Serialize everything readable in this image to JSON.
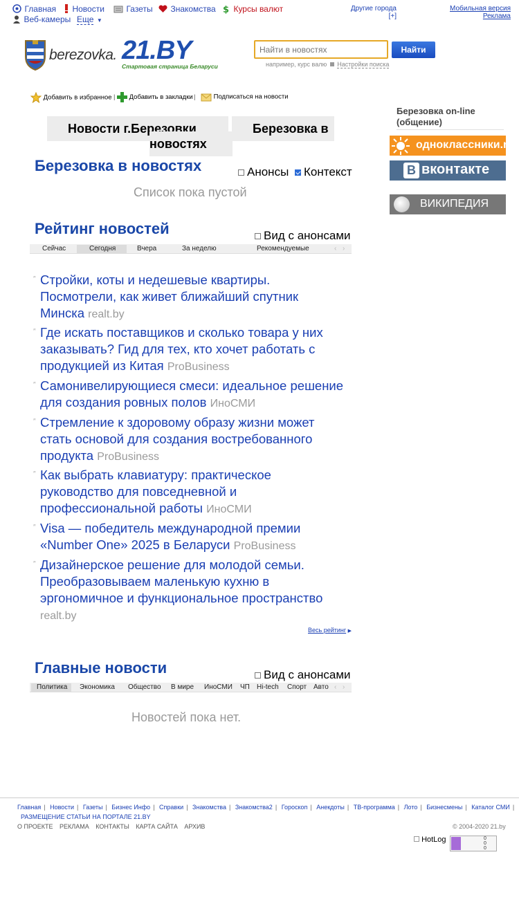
{
  "topnav": {
    "items": [
      {
        "label": "Главная",
        "icon": "home-icon"
      },
      {
        "label": "Новости",
        "icon": "exclamation-icon"
      },
      {
        "label": "Газеты",
        "icon": "newspaper-icon"
      },
      {
        "label": "Знакомства",
        "icon": "heart-icon"
      },
      {
        "label": "Курсы валют",
        "icon": "dollar-icon"
      }
    ],
    "webcams": "Веб-камеры",
    "more": "Еще",
    "other_cities": "Другие города",
    "other_cities_plus": "[+]",
    "mobile": "Мобильная версия",
    "ads": "Реклама"
  },
  "brand": {
    "city_logo_text": "berezovka.",
    "logo_text": "21.BY",
    "tagline": "Стартовая страница Беларуси"
  },
  "search": {
    "placeholder": "Найти в новостях",
    "button": "Найти",
    "example": "например, курс валю",
    "settings": "Настройки поиска"
  },
  "actions": {
    "favorites": "Добавить в избранное",
    "bookmarks": "Добавить в закладки",
    "subscribe": "Подписаться на новости"
  },
  "city_tabs": {
    "tab1": "Новости г.Березовки",
    "tab2": "Березовка в",
    "tab3": "новостях"
  },
  "sidebar": {
    "title": "Березовка on-line (общение)",
    "odnoklassniki": "одноклассники.ru",
    "vkontakte": "вконтакте",
    "wiki": "ВИКИПЕДИЯ"
  },
  "section1": {
    "title": "Березовка в новостях",
    "anons": "Анонсы",
    "context": "Контекст",
    "empty": "Список пока пустой"
  },
  "rating": {
    "title": "Рейтинг новостей",
    "view_anons": "Вид с анонсами",
    "tabs": [
      "Сейчас",
      "Сегодня",
      "Вчера",
      "За неделю",
      "Рекомендуемые"
    ],
    "items": [
      {
        "title": "Стройки, коты и недешевые квартиры. Посмотрели, как живет ближайший спутник Минска",
        "source": "realt.by"
      },
      {
        "title": "Где искать поставщиков и сколько товара у них заказывать? Гид для тех, кто хочет работать с продукцией из Китая",
        "source": "ProBusiness"
      },
      {
        "title": "Самонивелирующиеся смеси: идеальное решение для создания ровных полов",
        "source": "ИноСМИ"
      },
      {
        "title": "Стремление к здоровому образу жизни может стать основой для создания востребованного продукта",
        "source": "ProBusiness"
      },
      {
        "title": "Как выбрать клавиатуру: практическое руководство для повседневной и профессиональной работы",
        "source": "ИноСМИ"
      },
      {
        "title": "Visa — победитель международной премии «Number One» 2025 в Беларуси",
        "source": "ProBusiness"
      },
      {
        "title": "Дизайнерское решение для молодой семьи. Преобразовываем маленькую кухню в эргономичное и функциональное пространство",
        "source": "realt.by"
      }
    ],
    "all": "Весь рейтинг"
  },
  "main_news": {
    "title": "Главные новости",
    "view_anons": "Вид с анонсами",
    "tabs": [
      "Политика",
      "Экономика",
      "Общество",
      "В мире",
      "ИноСМИ",
      "ЧП",
      "Hi-tech",
      "Спорт",
      "Авто"
    ],
    "empty": "Новостей пока нет."
  },
  "footer": {
    "links": [
      "Главная",
      "Новости",
      "Газеты",
      "Бизнес Инфо",
      "Справки",
      "Знакомства",
      "Знакомства2",
      "Гороскоп",
      "Анекдоты",
      "ТВ-программа",
      "Лото",
      "Бизнесмены",
      "Каталог СМИ"
    ],
    "placement": "РАЗМЕЩЕНИЕ СТАТЬИ НА ПОРТАЛЕ 21.BY",
    "bottom": [
      "О ПРОЕКТЕ",
      "РЕКЛАМА",
      "КОНТАКТЫ",
      "КАРТА САЙТА",
      "АРХИВ"
    ],
    "copyright": "© 2004-2020 21.by",
    "hotlog": "HotLog",
    "counter": [
      "0",
      "0",
      "0"
    ]
  }
}
